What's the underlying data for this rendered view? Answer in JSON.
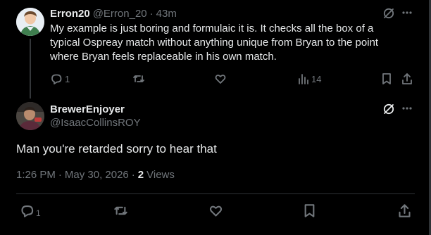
{
  "reply_tweet": {
    "display_name": "Erron20",
    "handle": "@Erron_20",
    "separator": "·",
    "time": "43m",
    "text": "My example is just boring and formulaic it is. It checks all the box of a typical Ospreay match without anything unique from Bryan to the point where Bryan feels replaceable in his own match.",
    "actions": {
      "replies": "1",
      "reposts": "",
      "likes": "",
      "views": "14"
    }
  },
  "main_tweet": {
    "display_name": "BrewerEnjoyer",
    "handle": "@IsaacCollinsROY",
    "text": "Man you're retarded sorry to hear that",
    "meta": {
      "time": "1:26 PM",
      "sep1": "·",
      "date": "May 30, 2026",
      "sep2": "·",
      "views_count": "2",
      "views_label": "Views"
    },
    "actions": {
      "replies": "1"
    }
  },
  "colors": {
    "background": "#000000",
    "text": "#e7e9ea",
    "muted": "#71767b",
    "divider": "#2f3336"
  }
}
